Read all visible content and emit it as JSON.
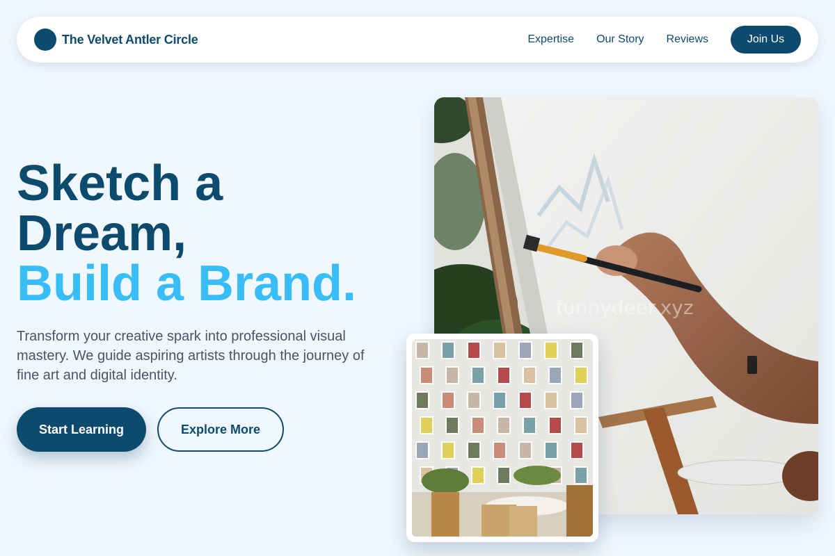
{
  "header": {
    "brand": "The Velvet Antler Circle",
    "nav_links": [
      "Expertise",
      "Our Story",
      "Reviews"
    ],
    "cta_label": "Join Us"
  },
  "hero": {
    "title_line1": "Sketch a",
    "title_line2": "Dream,",
    "title_accent": "Build a Brand.",
    "description": "Transform your creative spark into professional visual mastery. We guide aspiring artists through the journey of fine art and digital identity.",
    "primary_button": "Start Learning",
    "secondary_button": "Explore More"
  },
  "images": {
    "main_alt": "Hand painting on an easel canvas",
    "secondary_alt": "Art studio wall with clipped pictures and plants",
    "watermark": "funnydeer.xyz"
  },
  "colors": {
    "primary": "#0c4a6e",
    "accent": "#38bdf8",
    "background": "#f0f7fd",
    "text_muted": "#475569"
  }
}
